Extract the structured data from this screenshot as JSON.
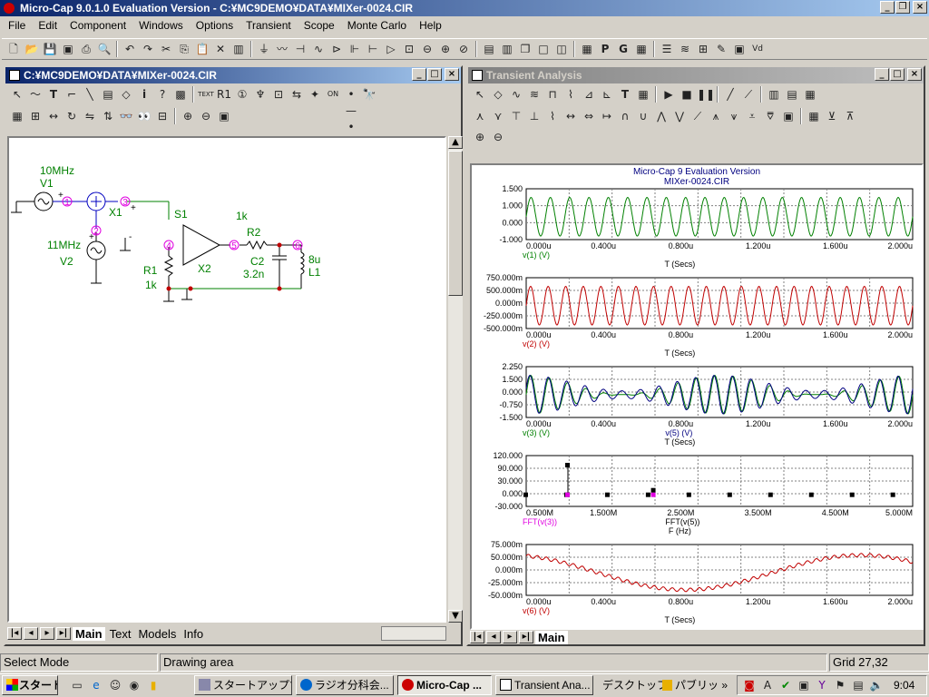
{
  "app_title": "Micro-Cap 9.0.1.0 Evaluation Version - C:¥MC9DEMO¥DATA¥MIXer-0024.CIR",
  "menu": [
    "File",
    "Edit",
    "Component",
    "Windows",
    "Options",
    "Transient",
    "Scope",
    "Monte Carlo",
    "Help"
  ],
  "schematic": {
    "title": "C:¥MC9DEMO¥DATA¥MIXer-0024.CIR",
    "tabs": [
      "Main",
      "Text",
      "Models",
      "Info"
    ],
    "components": {
      "v1_freq": "10MHz",
      "v1": "V1",
      "v2_freq": "11MHz",
      "v2": "V2",
      "x1": "X1",
      "s1": "S1",
      "x2": "X2",
      "r1": "R1",
      "r1_val": "1k",
      "r2": "R2",
      "r2_val": "1k",
      "c2": "C2",
      "c2_val": "3.2n",
      "l1": "L1",
      "l1_val": "8u",
      "n1": "1",
      "n2": "2",
      "n3": "3",
      "n4": "4",
      "n5": "5",
      "n6": "6",
      "plus": "+",
      "minus": "-"
    }
  },
  "analysis": {
    "title": "Transient Analysis",
    "header1": "Micro-Cap 9 Evaluation Version",
    "header2": "MIXer-0024.CIR",
    "tab": "Main",
    "plots": [
      {
        "ylabels": [
          "1.500",
          "1.000",
          "0.000",
          "-1.000"
        ],
        "xlabels": [
          "0.000u",
          "0.400u",
          "0.800u",
          "1.200u",
          "1.600u",
          "2.000u"
        ],
        "trace": "v(1) (V)",
        "trace_color": "#008000",
        "xaxis": "T (Secs)"
      },
      {
        "ylabels": [
          "750.000m",
          "500.000m",
          "0.000m",
          "-250.000m",
          "-500.000m"
        ],
        "xlabels": [
          "0.000u",
          "0.400u",
          "0.800u",
          "1.200u",
          "1.600u",
          "2.000u"
        ],
        "trace": "v(2) (V)",
        "trace_color": "#c00000",
        "xaxis": "T (Secs)"
      },
      {
        "ylabels": [
          "2.250",
          "1.500",
          "0.000",
          "-0.750",
          "-1.500"
        ],
        "xlabels": [
          "0.000u",
          "0.400u",
          "0.800u",
          "1.200u",
          "1.600u",
          "2.000u"
        ],
        "trace": "v(3) (V)",
        "trace2": "v(5) (V)",
        "trace_color": "#008000",
        "xaxis": "T (Secs)"
      },
      {
        "ylabels": [
          "120.000",
          "90.000",
          "30.000",
          "0.000",
          "-30.000"
        ],
        "xlabels": [
          "0.500M",
          "1.500M",
          "2.500M",
          "3.500M",
          "4.500M",
          "5.000M"
        ],
        "trace": "FFT(v(3))",
        "trace2": "FFT(v(5))",
        "trace_color": "#e000e0",
        "xaxis": "F (Hz)"
      },
      {
        "ylabels": [
          "75.000m",
          "50.000m",
          "0.000m",
          "-25.000m",
          "-50.000m"
        ],
        "xlabels": [
          "0.000u",
          "0.400u",
          "0.800u",
          "1.200u",
          "1.600u",
          "2.000u"
        ],
        "trace": "v(6) (V)",
        "trace_color": "#c00000",
        "xaxis": "T (Secs)"
      }
    ]
  },
  "status": {
    "mode": "Select Mode",
    "area": "Drawing area",
    "grid": "Grid 27,32"
  },
  "taskbar": {
    "start": "スタート",
    "tasks": [
      "スタートアップツ...",
      "ラジオ分科会...",
      "Micro-Cap ...",
      "Transient Ana..."
    ],
    "desktop": "デスクトップ",
    "public": "パブリッ",
    "time": "9:04"
  }
}
